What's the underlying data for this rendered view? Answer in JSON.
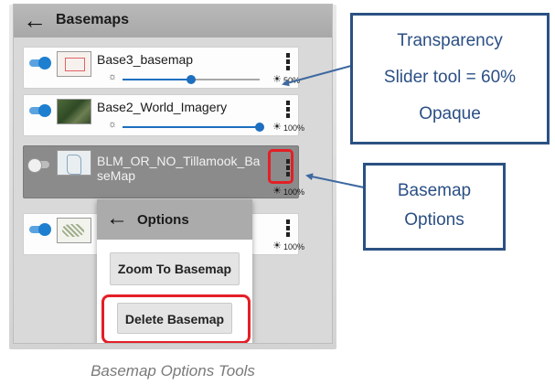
{
  "panel": {
    "header_title": "Basemaps",
    "back_icon": "arrow-left-icon",
    "layers": [
      {
        "name": "Base3_basemap",
        "enabled": true,
        "opacity_percent": 50,
        "opacity_label": "50%"
      },
      {
        "name": "Base2_World_Imagery",
        "enabled": true,
        "opacity_percent": 100,
        "opacity_label": "100%"
      },
      {
        "name_line1": "BLM_OR_NO_Tillamook_Ba",
        "name_line2": "seMap",
        "enabled": false,
        "opacity_percent": 100,
        "opacity_label": "100%"
      },
      {
        "name": "",
        "enabled": true,
        "opacity_label": "100%"
      }
    ]
  },
  "options_menu": {
    "title": "Options",
    "back_icon": "arrow-left-icon",
    "zoom_label": "Zoom To Basemap",
    "delete_label": "Delete Basemap"
  },
  "callouts": {
    "transparency": {
      "line1": "Transparency",
      "line2": "Slider tool = 60%",
      "line3": "Opaque"
    },
    "options": {
      "line1": "Basemap",
      "line2": "Options"
    }
  },
  "caption": "Basemap Options Tools",
  "colors": {
    "callout_border": "#2b5182",
    "callout_text": "#2b4f84",
    "highlight": "#e41f26",
    "toggle_on": "#1e7fd0"
  }
}
